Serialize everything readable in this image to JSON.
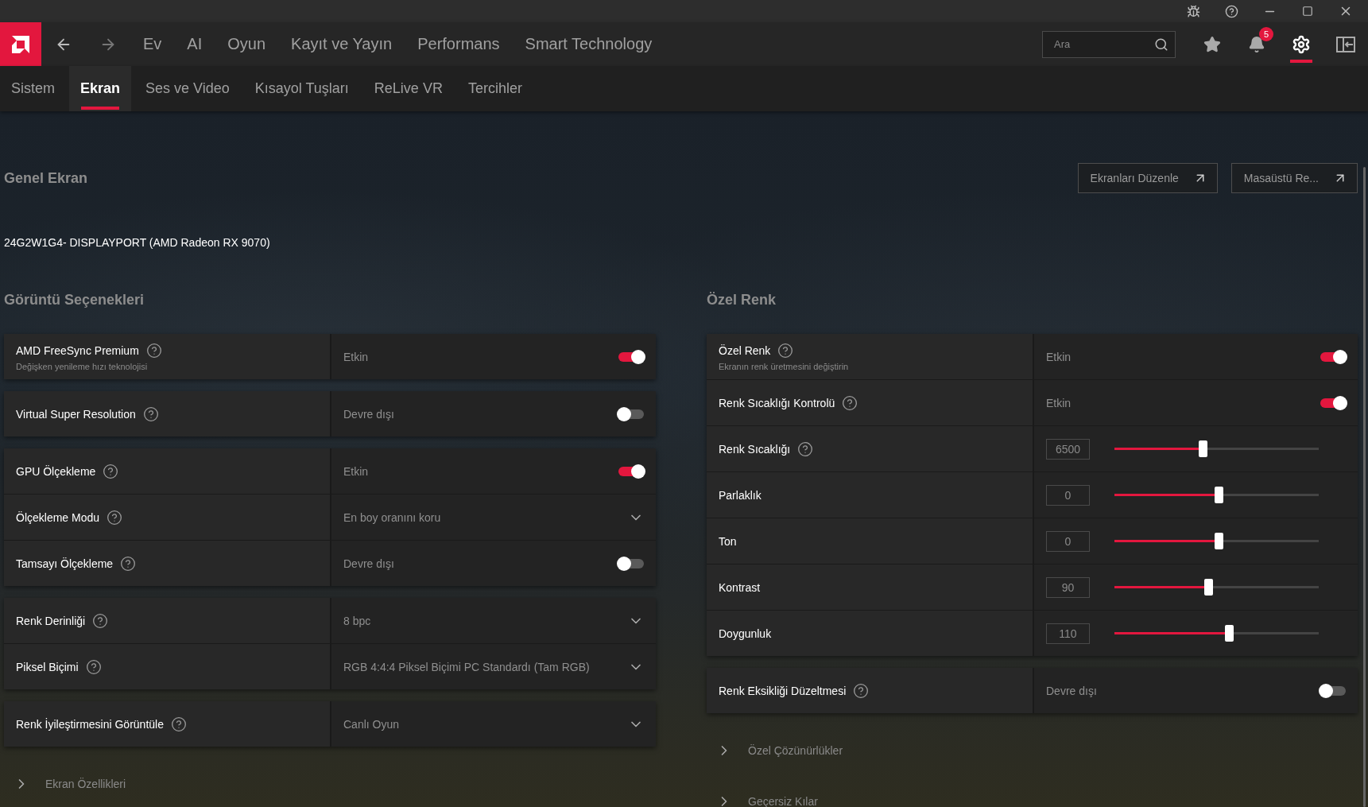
{
  "nav": {
    "items": [
      {
        "label": "Ev"
      },
      {
        "label": "AI"
      },
      {
        "label": "Oyun"
      },
      {
        "label": "Kayıt ve Yayın"
      },
      {
        "label": "Performans"
      },
      {
        "label": "Smart Technology"
      }
    ],
    "search": {
      "placeholder": "Ara"
    },
    "notification_count": "5"
  },
  "subtabs": [
    {
      "label": "Sistem",
      "selected": false
    },
    {
      "label": "Ekran",
      "selected": true
    },
    {
      "label": "Ses ve Video",
      "selected": false
    },
    {
      "label": "Kısayol Tuşları",
      "selected": false
    },
    {
      "label": "ReLive VR",
      "selected": false
    },
    {
      "label": "Tercihler",
      "selected": false
    }
  ],
  "page": {
    "title": "Genel Ekran",
    "buttons": [
      "Ekranları Düzenle",
      "Masaüstü Re..."
    ],
    "display_name": "24G2W1G4- DISPLAYPORT (AMD Radeon RX 9070)"
  },
  "sections": [
    {
      "title": "Görüntü Seçenekleri",
      "groups": [
        [
          {
            "kind": "toggle",
            "label": "AMD FreeSync Premium",
            "description": "Değişken yenileme hızı teknolojisi",
            "help": true,
            "value": "Etkin",
            "on": true
          }
        ],
        [
          {
            "kind": "toggle",
            "label": "Virtual Super Resolution",
            "help": true,
            "value": "Devre dışı",
            "on": false
          }
        ],
        [
          {
            "kind": "toggle",
            "label": "GPU Ölçekleme",
            "help": true,
            "value": "Etkin",
            "on": true
          },
          {
            "kind": "dropdown",
            "label": "Ölçekleme Modu",
            "help": true,
            "value": "En boy oranını koru"
          },
          {
            "kind": "toggle",
            "label": "Tamsayı Ölçekleme",
            "help": true,
            "value": "Devre dışı",
            "on": false
          }
        ],
        [
          {
            "kind": "dropdown",
            "label": "Renk Derinliği",
            "help": true,
            "value": "8 bpc"
          },
          {
            "kind": "dropdown",
            "label": "Piksel Biçimi",
            "help": true,
            "value": "RGB 4:4:4 Piksel Biçimi PC Standardı (Tam RGB)"
          }
        ],
        [
          {
            "kind": "dropdown",
            "label": "Renk İyileştirmesini Görüntüle",
            "help": true,
            "value": "Canlı Oyun"
          }
        ]
      ],
      "expanders": [
        "Ekran Özellikleri"
      ]
    },
    {
      "title": "Özel Renk",
      "groups": [
        [
          {
            "kind": "toggle",
            "label": "Özel Renk",
            "description": "Ekranın renk üretmesini değiştirin",
            "help": true,
            "value": "Etkin",
            "on": true
          },
          {
            "kind": "toggle",
            "label": "Renk Sıcaklığı Kontrolü",
            "help": true,
            "value": "Etkin",
            "on": true
          },
          {
            "kind": "slider",
            "label": "Renk Sıcaklığı",
            "help": true,
            "value": "6500",
            "level": 0.42
          },
          {
            "kind": "slider",
            "label": "Parlaklık",
            "help": false,
            "value": "0",
            "level": 0.5
          },
          {
            "kind": "slider",
            "label": "Ton",
            "help": false,
            "value": "0",
            "level": 0.5
          },
          {
            "kind": "slider",
            "label": "Kontrast",
            "help": false,
            "value": "90",
            "level": 0.45
          },
          {
            "kind": "slider",
            "label": "Doygunluk",
            "help": false,
            "value": "110",
            "level": 0.55
          }
        ],
        [
          {
            "kind": "toggle",
            "label": "Renk Eksikliği Düzeltmesi",
            "help": true,
            "value": "Devre dışı",
            "on": false
          }
        ]
      ],
      "expanders": [
        "Özel Çözünürlükler",
        "Geçersiz Kılar"
      ]
    }
  ]
}
